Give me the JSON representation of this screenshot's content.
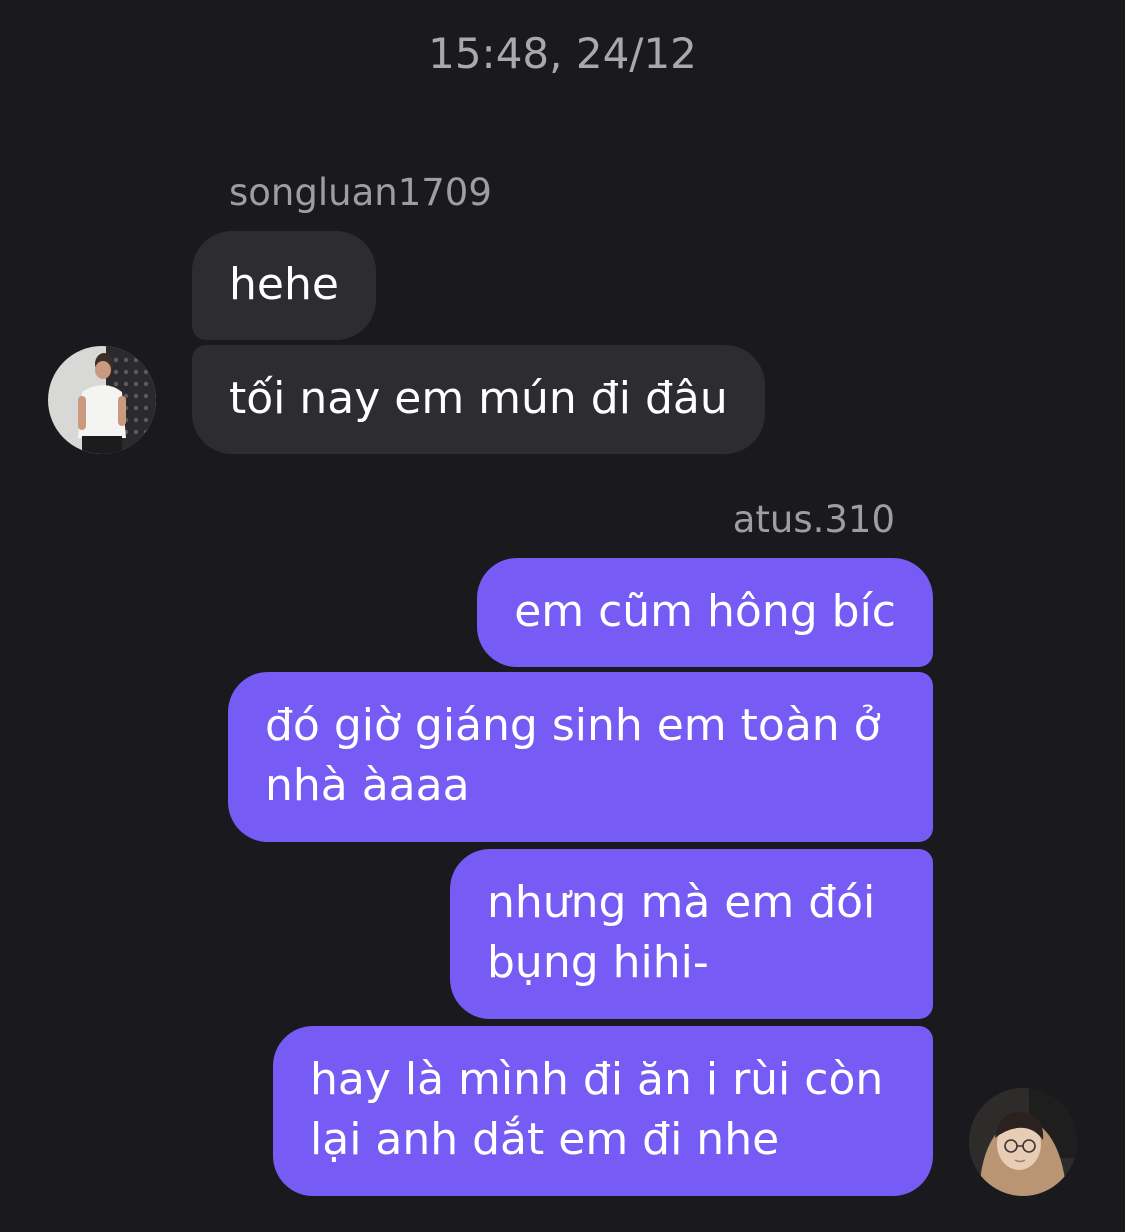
{
  "header": {
    "timestamp": "15:48, 24/12"
  },
  "conversation": {
    "incoming": {
      "sender": "songluan1709",
      "messages": [
        "hehe",
        "tối nay em mún đi đâu"
      ]
    },
    "outgoing": {
      "sender": "atus.310",
      "messages": [
        "em cũm hông bíc",
        "đó giờ giáng sinh em toàn ở\nnhà àaaa",
        "nhưng mà em đói\nbụng hihi-",
        "hay là mình đi ăn i rùi còn\nlại anh dắt em đi nhe"
      ]
    }
  },
  "colors": {
    "background": "#1a191d",
    "incoming_bubble": "#2d2d31",
    "outgoing_bubble": "#765cf4",
    "muted_text": "#9e9da3"
  },
  "icons": {
    "incoming_avatar": "avatar-photo",
    "outgoing_avatar": "avatar-photo"
  }
}
